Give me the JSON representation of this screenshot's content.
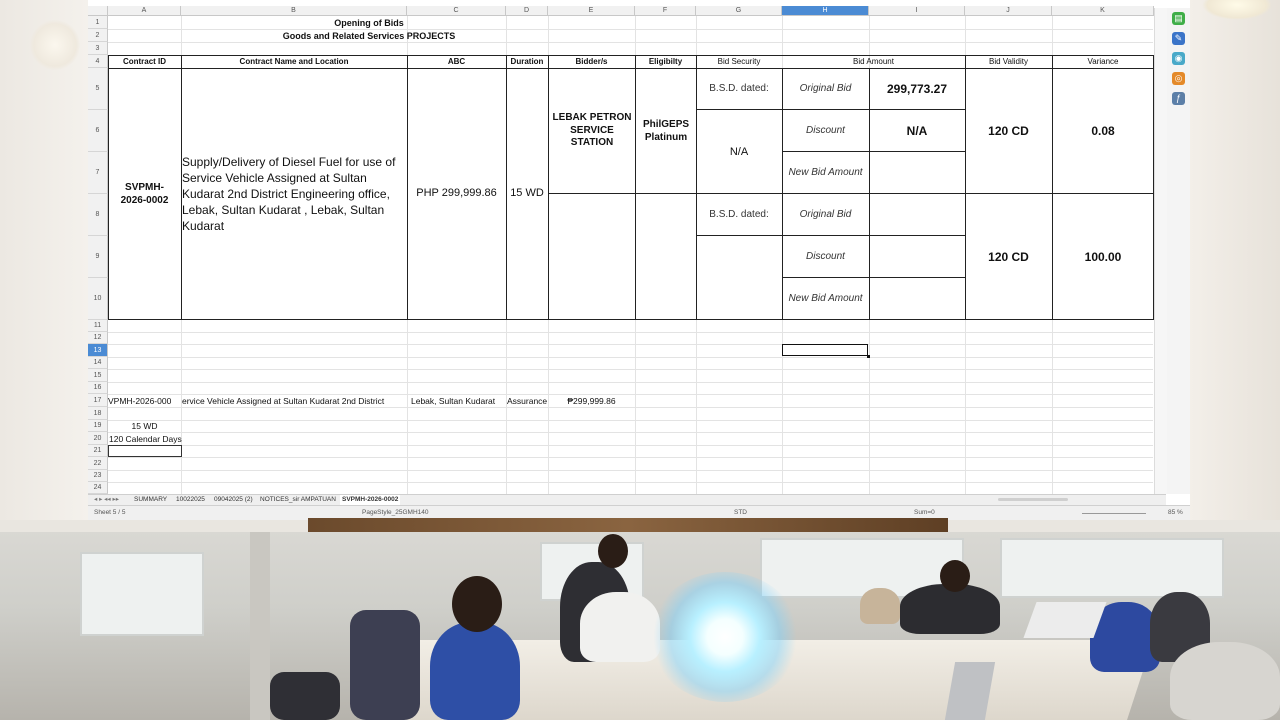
{
  "sheet": {
    "columns": [
      "A",
      "B",
      "C",
      "D",
      "E",
      "F",
      "G",
      "H",
      "I",
      "J",
      "K"
    ],
    "selected_column": "H",
    "rows": [
      "1",
      "2",
      "3",
      "4",
      "5",
      "6",
      "7",
      "8",
      "9",
      "10",
      "11",
      "12",
      "13",
      "14",
      "15",
      "16",
      "17",
      "18",
      "19",
      "20",
      "21",
      "22",
      "23",
      "24"
    ],
    "selected_row": "13",
    "title_line1": "Opening of Bids",
    "title_line2": "Goods and Related Services PROJECTS",
    "headers": {
      "contract_id": "Contract ID",
      "contract_name": "Contract Name and Location",
      "abc": "ABC",
      "duration": "Duration",
      "bidders": "Bidder/s",
      "eligibility": "Eligibilty",
      "bid_security": "Bid Security",
      "bid_amount": "Bid Amount",
      "bid_validity": "Bid Validity",
      "variance": "Variance"
    },
    "contract_id": "SVPMH-\n2026-0002",
    "contract_name": "Supply/Delivery of Diesel Fuel for use of Service Vehicle Assigned at Sultan Kudarat 2nd District Engineering office, Lebak, Sultan Kudarat  , Lebak, Sultan Kudarat",
    "abc": "PHP 299,999.86",
    "duration": "15 WD",
    "bidder1": {
      "name": "LEBAK PETRON SERVICE STATION",
      "eligibility": "PhilGEPS Platinum",
      "bsd_label": "B.S.D. dated:",
      "bid_security": "N/A",
      "original_bid_label": "Original Bid",
      "original_bid": "299,773.27",
      "discount_label": "Discount",
      "discount": "N/A",
      "new_bid_label": "New Bid Amount",
      "validity": "120 CD",
      "variance": "0.08"
    },
    "bidder2": {
      "bsd_label": "B.S.D. dated:",
      "original_bid_label": "Original Bid",
      "discount_label": "Discount",
      "new_bid_label": "New Bid Amount",
      "validity": "120 CD",
      "variance": "100.00"
    },
    "row17": {
      "a": "VPMH-2026-000",
      "b": "ervice Vehicle Assigned at Sultan Kudarat 2nd District",
      "c": "Lebak, Sultan Kudarat",
      "d": "Assurance",
      "e": "₱299,999.86"
    },
    "row19_a": "15 WD",
    "row20_a": "120 Calendar Days"
  },
  "tabs": [
    "SUMMARY",
    "10022025",
    "09042025 (2)",
    "NOTICES_sir AMPATUAN",
    "SVPMH-2026-0002"
  ],
  "active_tab": "SVPMH-2026-0002",
  "status": {
    "sheet": "Sheet 5 / 5",
    "page_style": "PageStyle_25GMH140",
    "mode": "STD",
    "sum": "Sum=0",
    "zoom": "85 %"
  }
}
